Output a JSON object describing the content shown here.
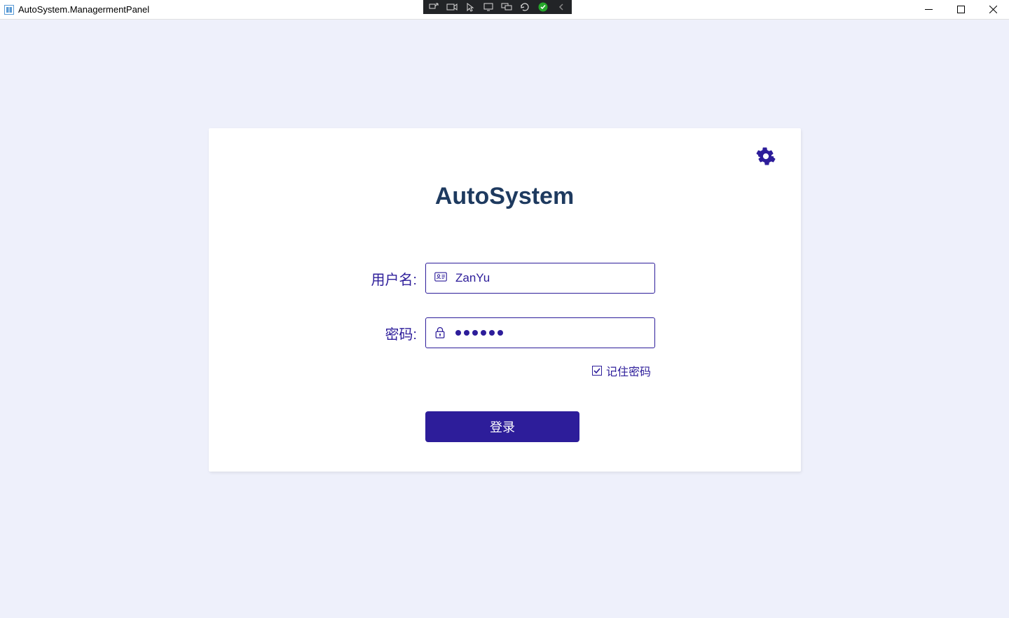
{
  "window": {
    "title": "AutoSystem.ManagermentPanel"
  },
  "login": {
    "heading": "AutoSystem",
    "username_label": "用户名:",
    "username_value": "ZanYu",
    "password_label": "密码:",
    "password_value": "••••••",
    "remember_label": "记住密码",
    "remember_checked": true,
    "login_button": "登录"
  },
  "colors": {
    "accent": "#2d1d9a",
    "card_bg": "#ffffff",
    "page_bg": "#eef0fb",
    "heading": "#1e3a5f"
  },
  "icons": {
    "gear": "gear-icon",
    "user": "user-card-icon",
    "lock": "lock-icon"
  }
}
